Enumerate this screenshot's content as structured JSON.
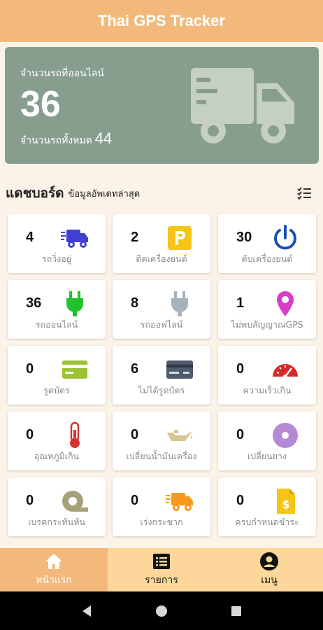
{
  "app": {
    "title": "Thai GPS Tracker"
  },
  "summary": {
    "online_label": "จำนวนรถที่ออนไลน์",
    "online_count": "36",
    "total_label": "จำนวนรถทั้งหมด",
    "total_count": "44",
    "icon": "truck-icon"
  },
  "dashboard": {
    "title": "แดชบอร์ด",
    "subtitle": "ข้อมูลอัพเดทล่าสุด",
    "menu_icon": "list-check-icon"
  },
  "cards": [
    {
      "count": "4",
      "label": "รถวิ่งอยู่",
      "icon": "moving-truck-icon",
      "color": "#3f3fd4"
    },
    {
      "count": "2",
      "label": "ติดเครื่องยนต์",
      "icon": "parking-icon",
      "color": "#f5c518"
    },
    {
      "count": "30",
      "label": "ดับเครื่องยนต์",
      "icon": "power-icon",
      "color": "#1a4fb8"
    },
    {
      "count": "36",
      "label": "รถออนไลน์",
      "icon": "plug-online-icon",
      "color": "#22c22e"
    },
    {
      "count": "8",
      "label": "รถออฟไลน์",
      "icon": "plug-offline-icon",
      "color": "#a7b3bc"
    },
    {
      "count": "1",
      "label": "ไม่พบสัญญาณGPS",
      "icon": "location-pin-icon",
      "color": "#d63fc4"
    },
    {
      "count": "0",
      "label": "รูดบัตร",
      "icon": "card-icon",
      "color": "#9bc232"
    },
    {
      "count": "6",
      "label": "ไม่ได้รูดบัตร",
      "icon": "card-dark-icon",
      "color": "#4f5a6b"
    },
    {
      "count": "0",
      "label": "ความเร็วเกิน",
      "icon": "speedometer-icon",
      "color": "#d62a2a"
    },
    {
      "count": "0",
      "label": "อุณหภูมิเกิน",
      "icon": "thermometer-icon",
      "color": "#d63232"
    },
    {
      "count": "0",
      "label": "เปลี่ยนน้ำมันเครื่อง",
      "icon": "oil-can-icon",
      "color": "#d8c690"
    },
    {
      "count": "0",
      "label": "เปลี่ยนยาง",
      "icon": "tire-icon",
      "color": "#b48ad4"
    },
    {
      "count": "0",
      "label": "เบรคกระทันหัน",
      "icon": "tape-roll-icon",
      "color": "#a5a27a"
    },
    {
      "count": "0",
      "label": "เร่งกระชาก",
      "icon": "fast-truck-icon",
      "color": "#f59a1d"
    },
    {
      "count": "0",
      "label": "ครบกำหนดชำระ",
      "icon": "invoice-icon",
      "color": "#f5c518"
    }
  ],
  "nav": [
    {
      "label": "หน้าแรก",
      "icon": "home-icon",
      "active": true
    },
    {
      "label": "รายการ",
      "icon": "list-icon",
      "active": false
    },
    {
      "label": "เมนู",
      "icon": "user-icon",
      "active": false
    }
  ],
  "system_nav": {
    "back": "back-icon",
    "home": "home-circle-icon",
    "recents": "recents-icon"
  }
}
